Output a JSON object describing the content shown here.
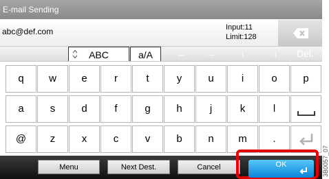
{
  "title": "E-mail Sending",
  "input": {
    "value": "abc@def.com",
    "input_count": "Input:11",
    "limit": "Limit:128"
  },
  "backspace_icon": "backspace-x-icon",
  "modes": {
    "abc": "ABC",
    "case": "a/A"
  },
  "nav": {
    "left": "←",
    "right": "→",
    "up": "↑",
    "down": "↓",
    "delete": "Del."
  },
  "rows": [
    [
      "q",
      "w",
      "e",
      "r",
      "t",
      "y",
      "u",
      "i",
      "o",
      "p"
    ],
    [
      "a",
      "s",
      "d",
      "f",
      "g",
      "h",
      "j",
      "k",
      "l"
    ],
    [
      "@",
      "z",
      "x",
      "c",
      "v",
      "b",
      "n",
      "m",
      "."
    ]
  ],
  "special_icons": {
    "space": "space-icon",
    "enter": "enter-icon"
  },
  "footer": {
    "menu": "Menu",
    "next_dest": "Next Dest.",
    "cancel": "Cancel",
    "ok": "OK"
  },
  "side_code": "3B0057_07",
  "colors": {
    "highlight": "#e00000",
    "ok_button": "#1a9ae6"
  }
}
